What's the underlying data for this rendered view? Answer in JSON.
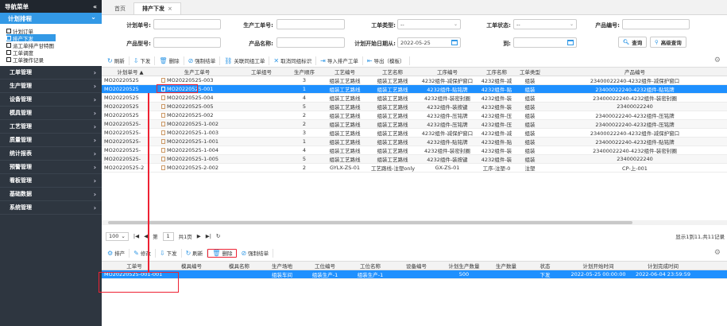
{
  "sidebar": {
    "title": "导航菜单",
    "collapse": "«",
    "top_item": "计划排程",
    "sub_items": [
      "计划订单",
      "排产下发",
      "派工单排产甘特图",
      "工单调度",
      "工单操作记录"
    ],
    "menus": [
      "工单管理",
      "生产管理",
      "设备管理",
      "模具管理",
      "工艺管理",
      "质量管理",
      "统计报表",
      "预警管理",
      "看板管理",
      "基础数据",
      "系统管理"
    ]
  },
  "tabs": [
    {
      "label": "首页"
    },
    {
      "label": "排产下发",
      "close": "×"
    }
  ],
  "search": {
    "plan_no_label": "计划单号:",
    "work_order_label": "生产工单号:",
    "process_type_label": "工单类型:",
    "process_type_value": "--",
    "status_label": "工单状态:",
    "status_value": "--",
    "product_no_label": "产品编号:",
    "model_label": "产品型号:",
    "product_name_label": "产品名称:",
    "plan_start_label": "计划开始日期从:",
    "plan_start_value": "2022-05-25",
    "to_label": "到:",
    "query": "查询",
    "advanced": "高级查询"
  },
  "toolbar1": [
    "刷新",
    "下发",
    "删除",
    "强制结单",
    "关联同组工单",
    "取消同组标识",
    "导入排产工单",
    "导出（模板）"
  ],
  "grid1": {
    "headers": [
      "计划单号 ▲",
      "生产工单号",
      "工单组号",
      "生产顺序",
      "工艺编号",
      "工艺名称",
      "工序编号",
      "工序名称",
      "工单类型",
      "产品编号"
    ],
    "rows": [
      [
        "MO20220525",
        "MO20220525-003",
        "",
        "3",
        "组装工艺路线",
        "组装工艺路线",
        "4232组件-减保护窗口",
        "4232组件-减",
        "组装",
        "23400022240-4232组件-减保护窗口"
      ],
      [
        "MO20220525",
        "MO20220525-001",
        "",
        "1",
        "组装工艺路线",
        "组装工艺路线",
        "4232组件-贴铭牌",
        "4232组件-贴",
        "组装",
        "23400022240-4232组件-贴铭牌"
      ],
      [
        "MO20220525",
        "MO20220525-004",
        "",
        "4",
        "组装工艺路线",
        "组装工艺路线",
        "4232组件-装密封圈",
        "4232组件-装",
        "组装",
        "23400022240-4232组件-装密封圈"
      ],
      [
        "MO20220525",
        "MO20220525-005",
        "",
        "5",
        "组装工艺路线",
        "组装工艺路线",
        "4232组件-装按键",
        "4232组件-装",
        "组装",
        "23400022240"
      ],
      [
        "MO20220525",
        "MO20220525-002",
        "",
        "2",
        "组装工艺路线",
        "组装工艺路线",
        "4232组件-压铭牌",
        "4232组件-压",
        "组装",
        "23400022240-4232组件-压铭牌"
      ],
      [
        "MO20220525-",
        "MO20220525-1-002",
        "",
        "2",
        "组装工艺路线",
        "组装工艺路线",
        "4232组件-压铭牌",
        "4232组件-压",
        "组装",
        "23400022240-4232组件-压铭牌"
      ],
      [
        "MO20220525-",
        "MO20220525-1-003",
        "",
        "3",
        "组装工艺路线",
        "组装工艺路线",
        "4232组件-减保护窗口",
        "4232组件-减",
        "组装",
        "23400022240-4232组件-减保护窗口"
      ],
      [
        "MO20220525-",
        "MO20220525-1-001",
        "",
        "1",
        "组装工艺路线",
        "组装工艺路线",
        "4232组件-贴铭牌",
        "4232组件-贴",
        "组装",
        "23400022240-4232组件-贴铭牌"
      ],
      [
        "MO20220525-",
        "MO20220525-1-004",
        "",
        "4",
        "组装工艺路线",
        "组装工艺路线",
        "4232组件-装密封圈",
        "4232组件-装",
        "组装",
        "23400022240-4232组件-装密封圈"
      ],
      [
        "MO20220525-",
        "MO20220525-1-005",
        "",
        "5",
        "组装工艺路线",
        "组装工艺路线",
        "4232组件-装按键",
        "4232组件-装",
        "组装",
        "23400022240"
      ],
      [
        "MO20220525-2",
        "MO20220525-2-002",
        "",
        "2",
        "GYLX-ZS-01",
        "工艺路线-注塑only",
        "GX-ZS-01",
        "工序-注塑-0",
        "注塑",
        "CP-上-001"
      ]
    ],
    "selected_row": 1
  },
  "pager": {
    "size": "100",
    "page_label_a": "第",
    "page": "1",
    "page_label_b": "共1页",
    "info": "显示1到11,共11记录"
  },
  "toolbar2": [
    "排产",
    "修改",
    "下发",
    "刷新",
    "删除",
    "强制结单"
  ],
  "grid2": {
    "headers": [
      "工单号",
      "模具编号",
      "模具名称",
      "生产场地",
      "工位编号",
      "工位名称",
      "设备编号",
      "计划生产数量",
      "生产数量",
      "状态",
      "计划开始时间",
      "计划完成时间"
    ],
    "rows": [
      [
        "MO20220525-001-001",
        "",
        "",
        "组装车间",
        "组装生产-1",
        "组装生产-1",
        "",
        "500",
        "",
        "下发",
        "2022-05-25 00:00:00",
        "2022-06-04 23:59:59"
      ]
    ]
  },
  "colors": {
    "accent": "#3399e6",
    "selected": "#1e90ff",
    "sidebar": "#2e3640",
    "highlight": "#ee2233"
  }
}
